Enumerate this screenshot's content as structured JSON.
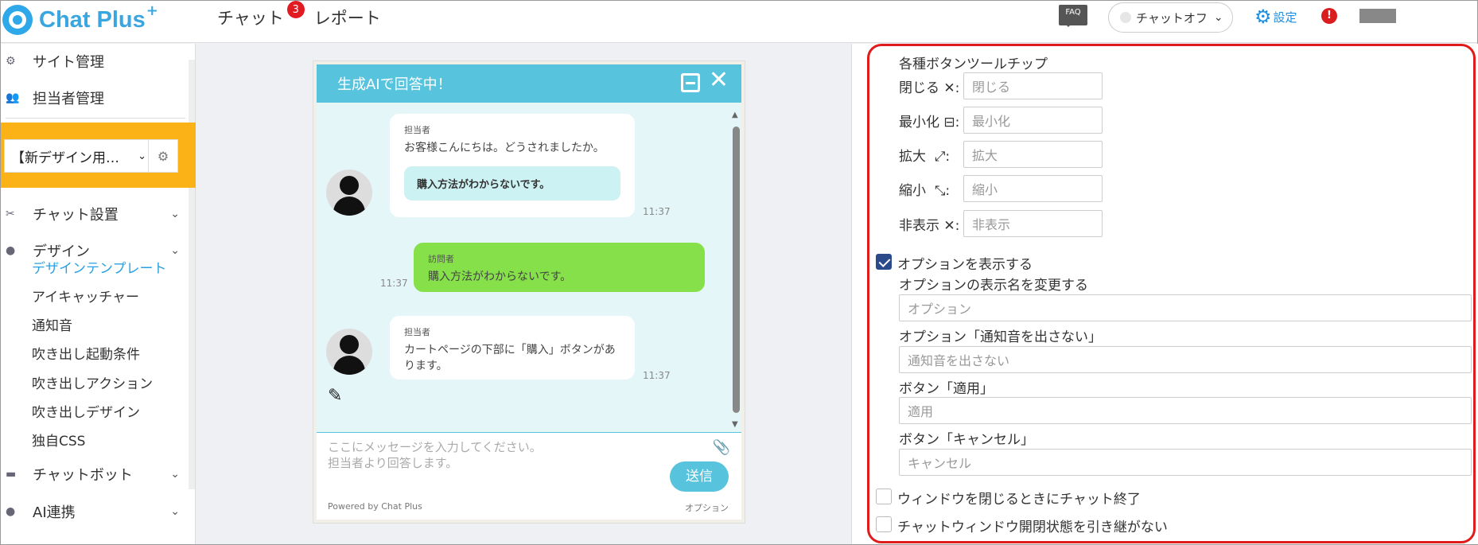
{
  "header": {
    "brand": "Chat Plus",
    "brand_plus": "+",
    "nav": [
      {
        "label": "チャット",
        "badge": "3"
      },
      {
        "label": "レポート"
      }
    ],
    "faq": "FAQ",
    "status": "チャットオフ",
    "settings": "設定",
    "alert": "!"
  },
  "sidebar": {
    "top_items": [
      {
        "label": "サイト管理",
        "icon": "gear-group-icon"
      },
      {
        "label": "担当者管理",
        "icon": "people-icon"
      }
    ],
    "site_select": "【新デザイン用…",
    "sections": [
      {
        "label": "チャット設置",
        "icon": "tools-icon"
      },
      {
        "label": "デザイン",
        "icon": "palette-icon"
      }
    ],
    "design_sub": [
      "デザインテンプレート",
      "アイキャッチャー",
      "通知音",
      "吹き出し起動条件",
      "吹き出しアクション",
      "吹き出しデザイン",
      "独自CSS"
    ],
    "bottom_sections": [
      {
        "label": "チャットボット",
        "icon": "chat-icon"
      },
      {
        "label": "AI連携",
        "icon": "ai-icon"
      }
    ]
  },
  "chat_preview": {
    "title": "生成AIで回答中！",
    "messages": [
      {
        "role": "agent",
        "who": "担当者",
        "text": "お客様こんにちは。どうされましたか。",
        "quote": "購入方法がわからないです。",
        "time": "11:37"
      },
      {
        "role": "visitor",
        "who": "訪問者",
        "text": "購入方法がわからないです。",
        "time": "11:37"
      },
      {
        "role": "agent",
        "who": "担当者",
        "text": "カートページの下部に「購入」ボタンがあります。",
        "time": "11:37"
      }
    ],
    "input_placeholder_1": "ここにメッセージを入力してください。",
    "input_placeholder_2": "担当者より回答します。",
    "send": "送信",
    "powered": "Powered by Chat Plus",
    "option": "オプション"
  },
  "settings": {
    "tooltip_title": "各種ボタンツールチップ",
    "tooltips": [
      {
        "label": "閉じる",
        "symbol": "✕",
        "placeholder": "閉じる"
      },
      {
        "label": "最小化",
        "symbol": "⊟",
        "placeholder": "最小化"
      },
      {
        "label": "拡大",
        "symbol": "⤢",
        "placeholder": "拡大"
      },
      {
        "label": "縮小",
        "symbol": "⤡",
        "placeholder": "縮小"
      },
      {
        "label": "非表示",
        "symbol": "✕",
        "placeholder": "非表示"
      }
    ],
    "show_option": {
      "label": "オプションを表示する",
      "checked": true
    },
    "option_fields": [
      {
        "label": "オプションの表示名を変更する",
        "placeholder": "オプション"
      },
      {
        "label": "オプション「通知音を出さない」",
        "placeholder": "通知音を出さない"
      },
      {
        "label": "ボタン「適用」",
        "placeholder": "適用"
      },
      {
        "label": "ボタン「キャンセル」",
        "placeholder": "キャンセル"
      }
    ],
    "end_on_close": {
      "label": "ウィンドウを閉じるときにチャット終了",
      "checked": false
    },
    "no_inherit": {
      "label": "チャットウィンドウ開閉状態を引き継がない",
      "checked": false
    }
  },
  "colors": {
    "accent": "#57c3dd",
    "highlight": "#fbb216",
    "frame": "#e01b1b",
    "visitor": "#86e04a"
  }
}
